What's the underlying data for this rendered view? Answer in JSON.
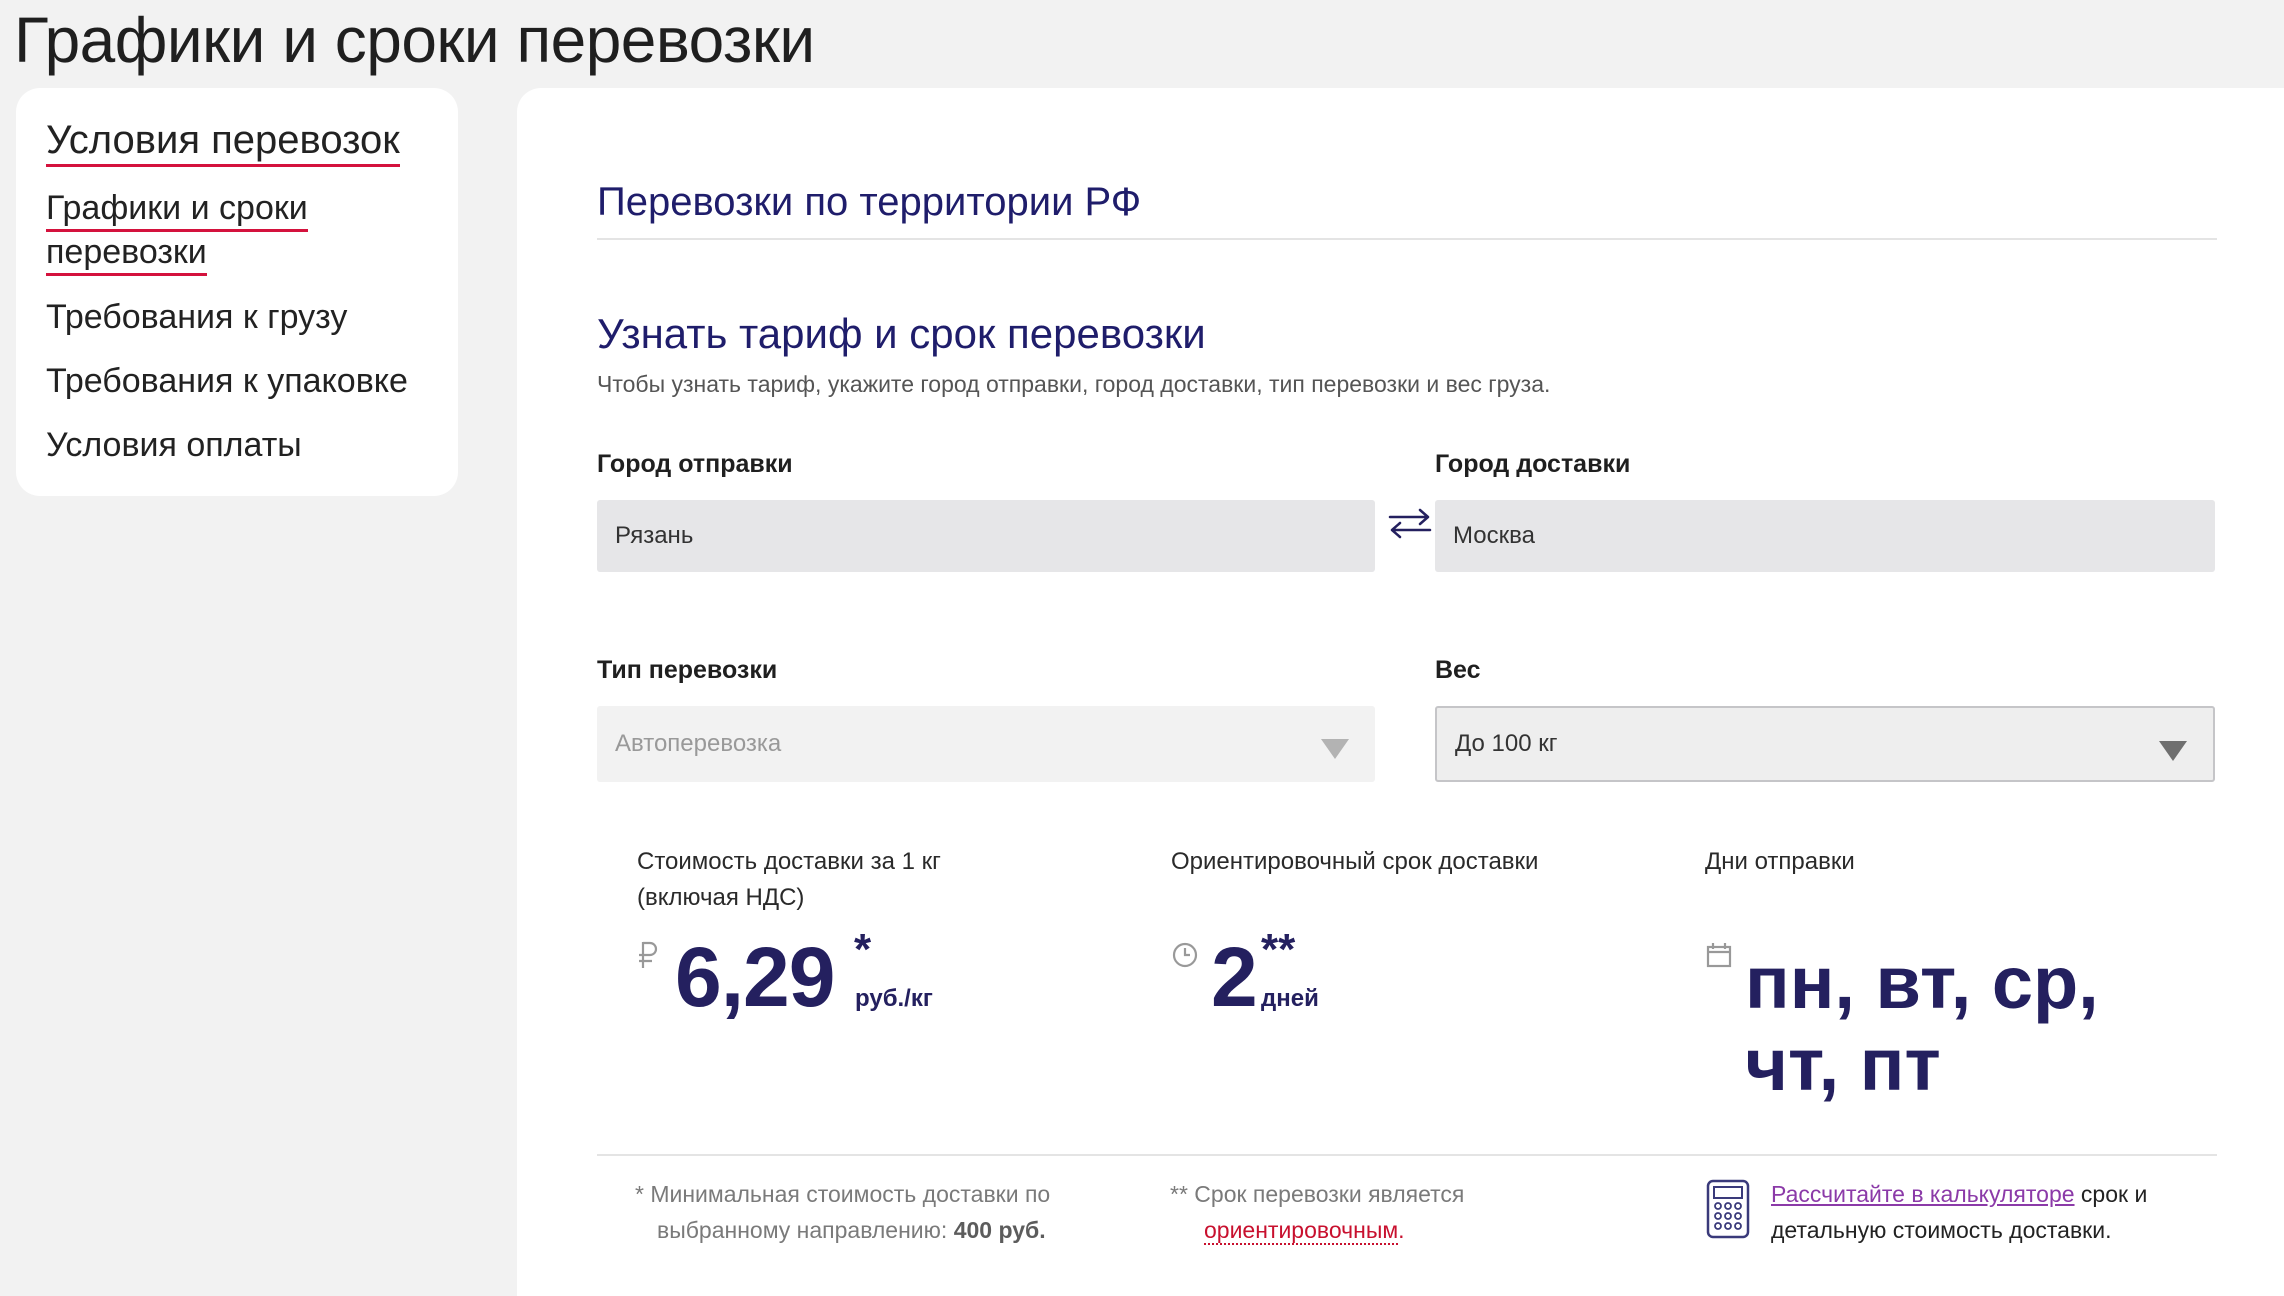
{
  "page_title": "Графики и сроки перевозки",
  "sidebar": {
    "items": [
      {
        "label": "Условия перевозок"
      },
      {
        "label_line1": "Графики и сроки",
        "label_line2": "перевозки"
      },
      {
        "label": "Требования к грузу"
      },
      {
        "label": "Требования к упаковке"
      },
      {
        "label": "Условия оплаты"
      }
    ]
  },
  "main": {
    "section_title": "Перевозки по территории РФ",
    "calc_title": "Узнать тариф и срок перевозки",
    "calc_subtitle": "Чтобы узнать тариф, укажите город отправки, город доставки, тип перевозки и вес груза.",
    "from": {
      "label": "Город отправки",
      "value": "Рязань"
    },
    "to": {
      "label": "Город доставки",
      "value": "Москва"
    },
    "type": {
      "label": "Тип перевозки",
      "value": "Автоперевозка"
    },
    "weight": {
      "label": "Вес",
      "value": "До 100 кг"
    },
    "results": {
      "cost": {
        "label_line1": "Стоимость доставки за 1 кг",
        "label_line2": "(включая НДС)",
        "icon": "ruble-icon",
        "value": "6,29",
        "mark": "*",
        "unit": "руб./кг"
      },
      "term": {
        "label": "Ориентировочный срок доставки",
        "icon": "clock-icon",
        "value": "2",
        "mark": "**",
        "unit": "дней"
      },
      "days": {
        "label": "Дни отправки",
        "icon": "calendar-icon",
        "line1": "пн, вт, ср,",
        "line2": "чт, пт"
      }
    },
    "notes": {
      "note1_line1": "* Минимальная стоимость доставки по",
      "note1_line2_prefix": "выбранному направлению: ",
      "note1_line2_bold": "400 руб.",
      "note2_line1": "** Срок перевозки является",
      "note2_link": "ориентировочным",
      "note2_end": ".",
      "note3_link": "Рассчитайте в калькуляторе",
      "note3_rest1": " срок и",
      "note3_line2": "детальную стоимость доставки."
    },
    "colors": {
      "accent": "#d4123d",
      "brand_navy": "#24205f",
      "link_purple": "#8b3aa8"
    }
  }
}
